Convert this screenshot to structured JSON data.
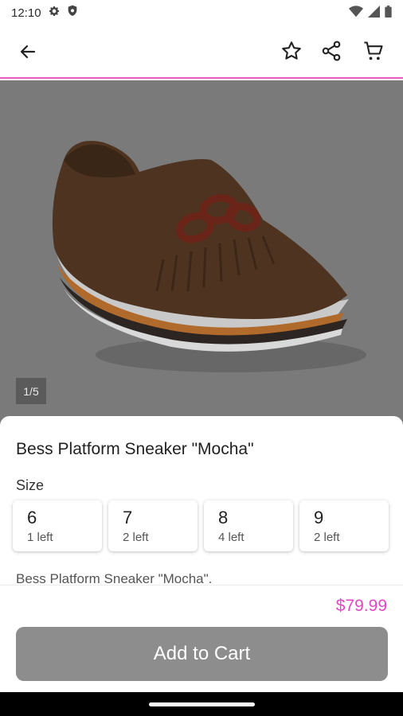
{
  "status": {
    "time": "12:10",
    "icons": [
      "settings-icon",
      "shield-icon",
      "wifi-icon",
      "signal-icon",
      "battery-icon"
    ]
  },
  "toolbar": {
    "icons": [
      "back-arrow-icon",
      "star-icon",
      "share-icon",
      "cart-icon"
    ]
  },
  "image": {
    "counter": "1/5"
  },
  "product": {
    "title": "Bess Platform Sneaker \"Mocha\"",
    "size_label": "Size",
    "sizes": [
      {
        "size": "6",
        "stock": "1 left"
      },
      {
        "size": "7",
        "stock": "2 left"
      },
      {
        "size": "8",
        "stock": "4 left"
      },
      {
        "size": "9",
        "stock": "2 left"
      }
    ],
    "description": "Bess Platform Sneaker \"Mocha\"."
  },
  "footer": {
    "price": "$79.99",
    "add_to_cart": "Add to Cart"
  },
  "colors": {
    "accent": "#e446c0",
    "divider": "#e85dc4",
    "button": "#8d8d8d"
  }
}
